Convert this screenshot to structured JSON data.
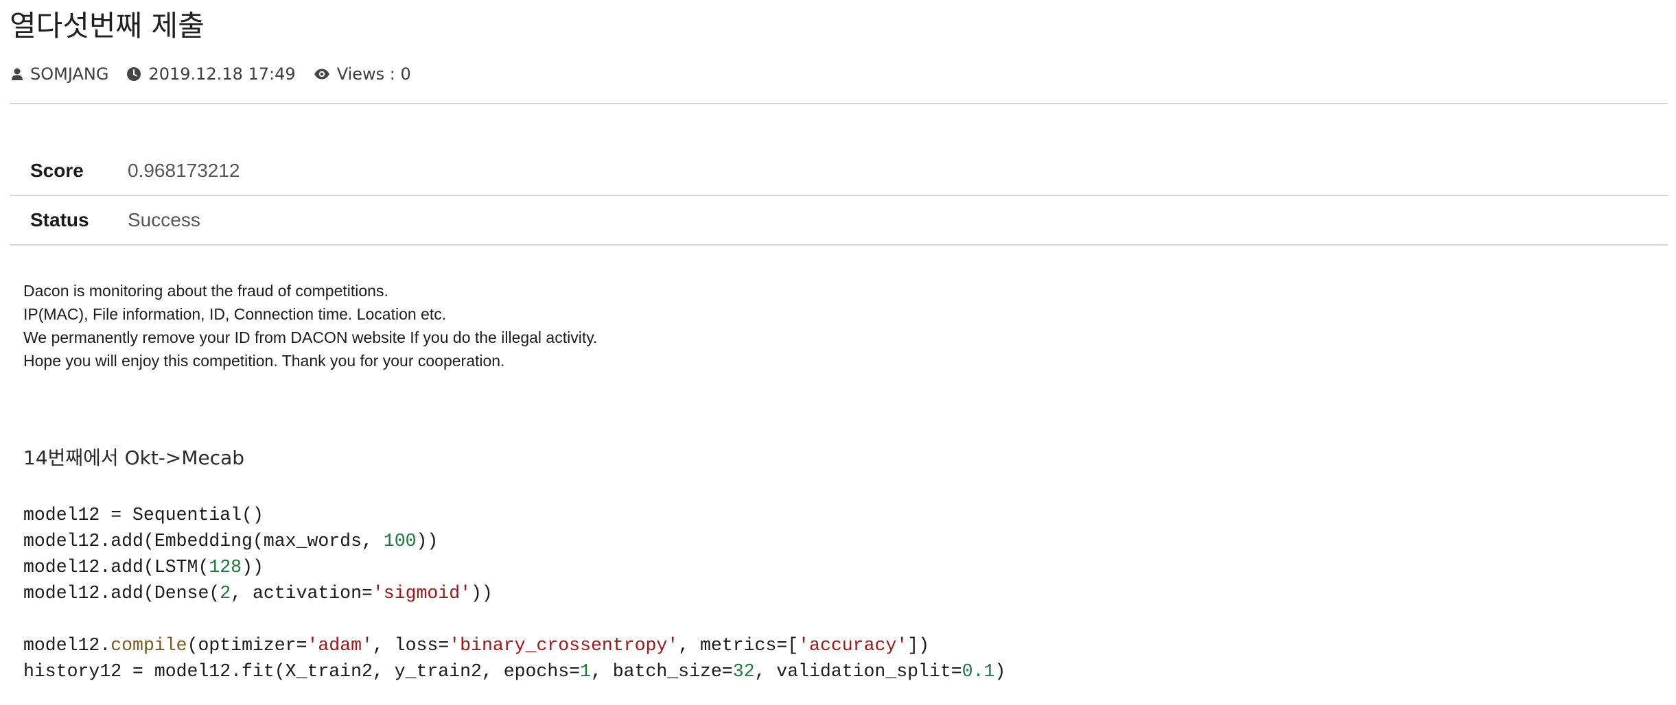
{
  "post": {
    "title": "열다섯번째 제출",
    "author": "SOMJANG",
    "datetime": "2019.12.18 17:49",
    "views": "Views : 0"
  },
  "result": {
    "score_label": "Score",
    "score_value": "0.968173212",
    "status_label": "Status",
    "status_value": "Success"
  },
  "notice": {
    "lines": [
      "Dacon is monitoring about the fraud of competitions.",
      "IP(MAC), File information, ID, Connection time. Location etc.",
      "We permanently remove your ID from DACON website If you do the illegal activity.",
      "Hope you will enjoy this competition. Thank you for your cooperation."
    ]
  },
  "description": "14번째에서 Okt->Mecab",
  "code": {
    "lines": [
      [
        {
          "t": "model12 = Sequential()",
          "k": ""
        }
      ],
      [
        {
          "t": "model12.add(Embedding(max_words, ",
          "k": ""
        },
        {
          "t": "100",
          "k": "num"
        },
        {
          "t": "))",
          "k": ""
        }
      ],
      [
        {
          "t": "model12.add(LSTM(",
          "k": ""
        },
        {
          "t": "128",
          "k": "num"
        },
        {
          "t": "))",
          "k": ""
        }
      ],
      [
        {
          "t": "model12.add(Dense(",
          "k": ""
        },
        {
          "t": "2",
          "k": "num"
        },
        {
          "t": ", activation=",
          "k": ""
        },
        {
          "t": "'sigmoid'",
          "k": "str"
        },
        {
          "t": "))",
          "k": ""
        }
      ],
      [],
      [
        {
          "t": "model12.",
          "k": ""
        },
        {
          "t": "compile",
          "k": "fn"
        },
        {
          "t": "(optimizer=",
          "k": ""
        },
        {
          "t": "'adam'",
          "k": "str"
        },
        {
          "t": ", loss=",
          "k": ""
        },
        {
          "t": "'binary_crossentropy'",
          "k": "str"
        },
        {
          "t": ", metrics=[",
          "k": ""
        },
        {
          "t": "'accuracy'",
          "k": "str"
        },
        {
          "t": "])",
          "k": ""
        }
      ],
      [
        {
          "t": "history12 = model12.fit(X_train2, y_train2, epochs=",
          "k": ""
        },
        {
          "t": "1",
          "k": "num"
        },
        {
          "t": ", batch_size=",
          "k": ""
        },
        {
          "t": "32",
          "k": "num"
        },
        {
          "t": ", validation_split=",
          "k": ""
        },
        {
          "t": "0.1",
          "k": "num"
        },
        {
          "t": ")",
          "k": ""
        }
      ]
    ]
  },
  "icons": {
    "author": "user-icon",
    "datetime": "clock-icon",
    "views": "eye-icon"
  },
  "colors": {
    "divider": "#d6d6d6",
    "code_number": "#1b7a3c",
    "code_string": "#a31515",
    "code_function": "#7a5b1a"
  }
}
